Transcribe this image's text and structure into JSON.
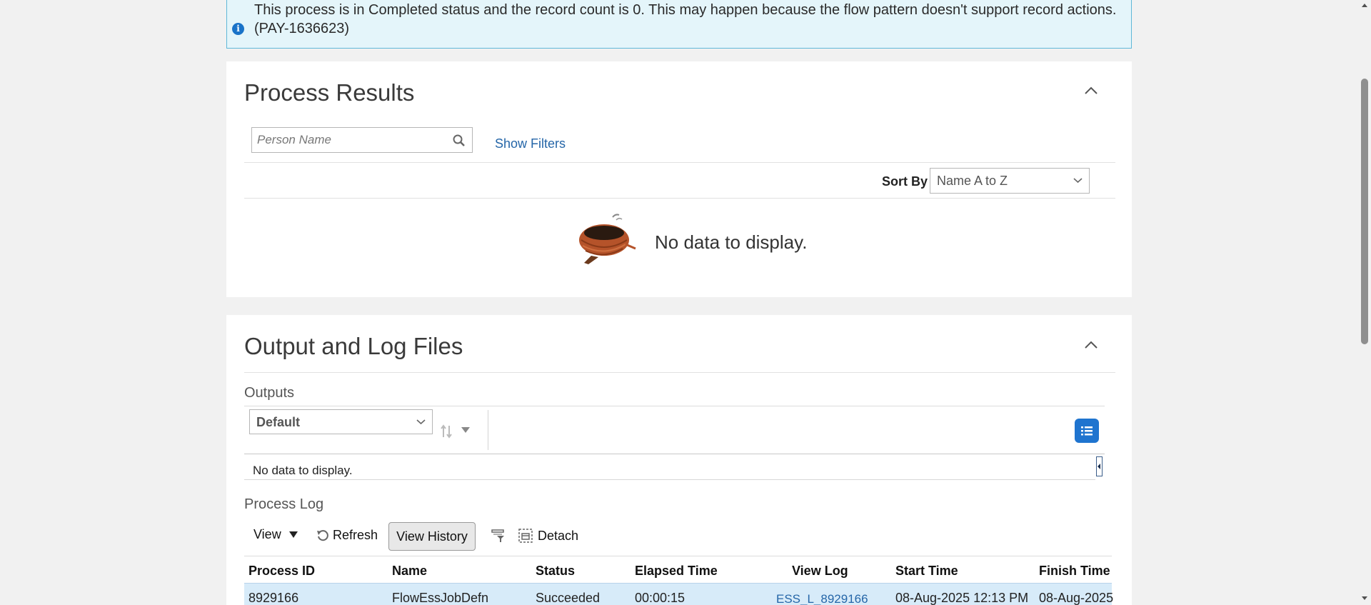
{
  "banner": {
    "icon": "info-icon",
    "message": "This process is in Completed status and the record count is 0. This may happen because the flow pattern doesn't support record actions. (PAY-1636623)"
  },
  "process_results": {
    "title": "Process Results",
    "search_placeholder": "Person Name",
    "show_filters": "Show Filters",
    "sort_label": "Sort By",
    "sort_value": "Name A to Z",
    "no_data": "No data to display."
  },
  "output_log": {
    "title": "Output and Log Files",
    "outputs_label": "Outputs",
    "view_select": "Default",
    "no_data": "No data to display.",
    "process_log_label": "Process Log",
    "toolbar": {
      "view": "View",
      "refresh": "Refresh",
      "view_history": "View History",
      "detach": "Detach"
    },
    "table": {
      "headers": [
        "Process ID",
        "Name",
        "Status",
        "Elapsed Time",
        "View Log",
        "Start Time",
        "Finish Time"
      ],
      "rows": [
        [
          "8929166",
          "FlowEssJobDefn",
          "Succeeded",
          "00:00:15",
          "ESS_L_8929166",
          "08-Aug-2025 12:13 PM",
          "08-Aug-2025"
        ]
      ]
    }
  },
  "colors": {
    "banner_bg": "#e4f5fa",
    "banner_border": "#5fb8d8",
    "link": "#2566a8",
    "selected_row": "#d7ebf9",
    "accent": "#1f74cf"
  }
}
